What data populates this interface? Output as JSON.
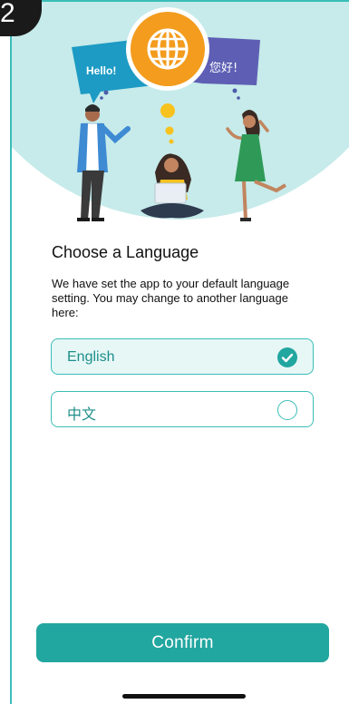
{
  "step_badge": {
    "number": "2"
  },
  "hero": {
    "bubble_left": "Hello!",
    "bubble_right": "您好!",
    "globe_icon": "globe-icon"
  },
  "page": {
    "title": "Choose a Language",
    "description": "We have set the app to your default language setting. You may change to another language here:"
  },
  "languages": [
    {
      "label": "English",
      "selected": true
    },
    {
      "label": "中文",
      "selected": false
    }
  ],
  "confirm_label": "Confirm",
  "colors": {
    "accent": "#22a6a0",
    "accent_light": "#e6f7f6",
    "hero_bg": "#c6ebea",
    "bubble_blue": "#1d9bc4",
    "bubble_purple": "#5e5fb4",
    "globe_orange": "#f39c1d"
  }
}
